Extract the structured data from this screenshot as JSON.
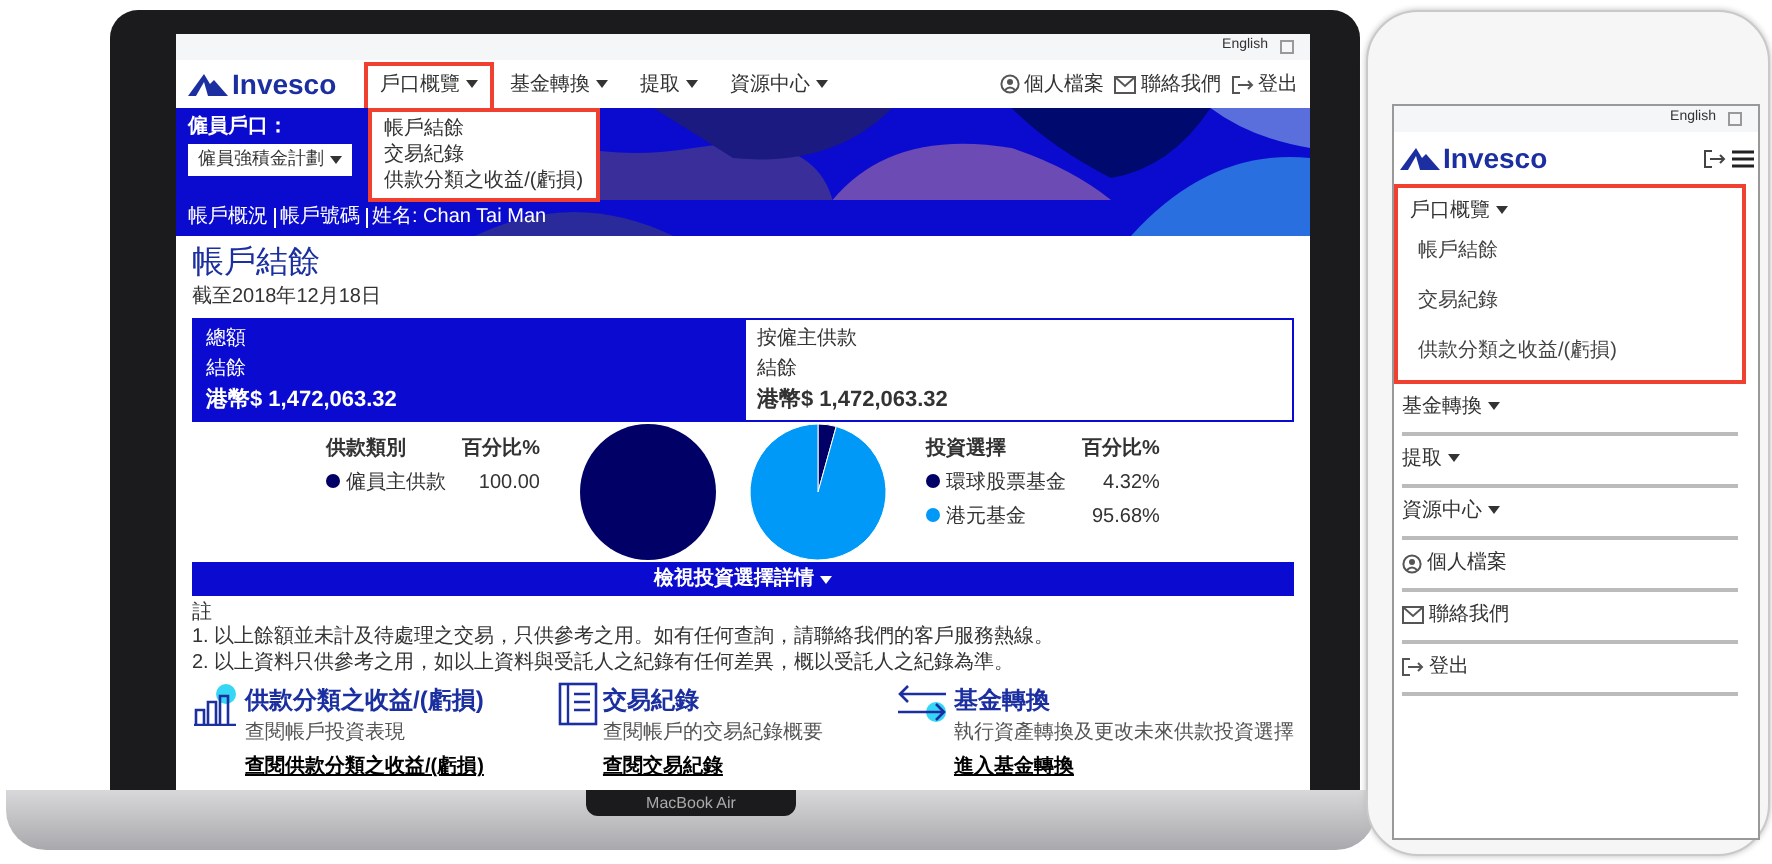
{
  "laptop": {
    "label": "MacBook Air",
    "site": {
      "language": "English",
      "logo": "Invesco",
      "nav": [
        {
          "label": "戶口概覽",
          "expanded": true,
          "menu": [
            "帳戶結餘",
            "交易紀錄",
            "供款分類之收益/(虧損)"
          ]
        },
        {
          "label": "基金轉換",
          "expanded": false
        },
        {
          "label": "提取",
          "expanded": false
        },
        {
          "label": "資源中心",
          "expanded": false
        }
      ],
      "user_links": [
        {
          "label": "個人檔案"
        },
        {
          "label": "聯絡我們"
        },
        {
          "label": "登出"
        }
      ],
      "account_selector": {
        "label": "僱員戶口：",
        "value": "僱員強積金計劃"
      },
      "breadcrumb": [
        "帳戶概況",
        "帳戶號碼",
        "姓名: Chan Tai Man"
      ],
      "page_title": "帳戶結餘",
      "as_of": "截至2018年12月18日",
      "summary_cards": [
        {
          "title": "總額",
          "label": "結餘",
          "amount": "港幣$ 1,472,063.32",
          "selected": true
        },
        {
          "title": "按僱主供款",
          "label": "結餘",
          "amount": "港幣$ 1,472,063.32",
          "selected": false
        }
      ],
      "charts": [
        {
          "legend_headers": [
            "供款類別",
            "百分比%"
          ],
          "legend": [
            {
              "value": "100.00",
              "color": "#000066"
            }
          ],
          "chart_data": {
            "type": "pie",
            "categories": [
              "僱員主供款"
            ],
            "values": [
              100
            ]
          }
        },
        {
          "legend_headers": [
            "投資選擇",
            "百分比%"
          ],
          "legend": [
            {
              "value": "4.32%",
              "color": "#000066"
            },
            {
              "value": "95.68%",
              "color": "#0099f7"
            }
          ],
          "chart_data": {
            "type": "pie",
            "categories": [
              "環球股票基金",
              "港元基金"
            ],
            "values": [
              4.32,
              95.68
            ]
          }
        }
      ],
      "details_button": "檢視投資選擇詳情",
      "notes": {
        "heading": "註",
        "items": [
          "1. 以上餘額並未計及待處理之交易，只供參考之用。如有任何查詢，請聯絡我們的客戶服務熱線。",
          "2. 以上資料只供參考之用，如以上資料與受託人之紀錄有任何差異，概以受託人之紀錄為準。"
        ]
      },
      "features": [
        {
          "title": "供款分類之收益/(虧損)",
          "subtitle": "查閱帳戶投資表現",
          "link": "查閱供款分類之收益/(虧損)"
        },
        {
          "title": "交易紀錄",
          "subtitle": "查閱帳戶的交易紀錄概要",
          "link": "查閱交易紀錄"
        },
        {
          "title": "基金轉換",
          "subtitle": "執行資產轉換及更改未來供款投資選擇",
          "link": "進入基金轉換"
        }
      ]
    }
  },
  "phone": {
    "language": "English",
    "logo": "Invesco",
    "menu": [
      {
        "kind": "dropdown",
        "label": "戶口概覽",
        "expanded": true,
        "children": [
          "帳戶結餘",
          "交易紀錄",
          "供款分類之收益/(虧損)"
        ]
      },
      {
        "kind": "dropdown",
        "label": "基金轉換",
        "expanded": false
      },
      {
        "kind": "dropdown",
        "label": "提取",
        "expanded": false
      },
      {
        "kind": "dropdown",
        "label": "資源中心",
        "expanded": false
      },
      {
        "kind": "link",
        "label": "個人檔案"
      },
      {
        "kind": "link",
        "label": "聯絡我們"
      },
      {
        "kind": "link",
        "label": "登出"
      }
    ]
  }
}
